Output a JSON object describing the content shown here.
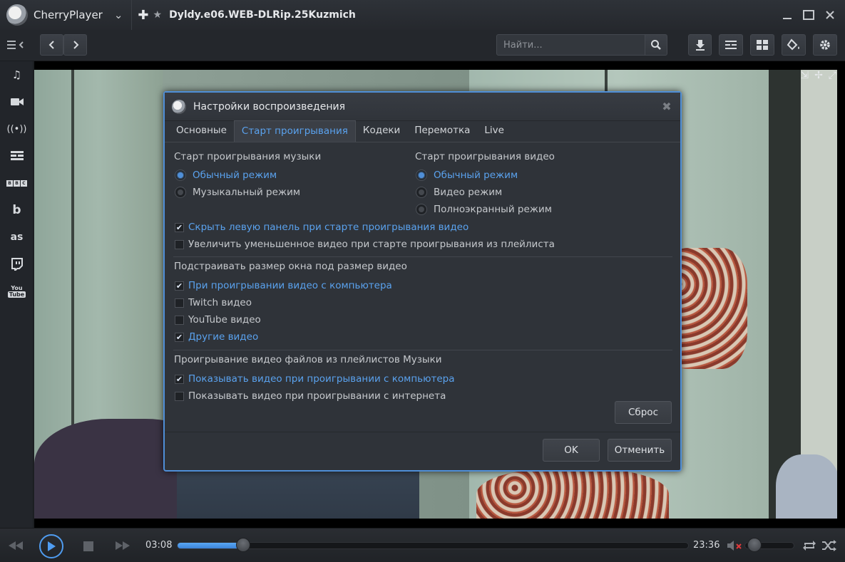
{
  "titlebar": {
    "app_name": "CherryPlayer",
    "doc_title": "Dyldy.e06.WEB-DLRip.25Kuzmich"
  },
  "toolbar": {
    "search_placeholder": "Найти..."
  },
  "dialog": {
    "title": "Настройки воспроизведения",
    "tabs": [
      {
        "label": "Основные",
        "active": false
      },
      {
        "label": "Старт проигрывания",
        "active": true
      },
      {
        "label": "Кодеки",
        "active": false
      },
      {
        "label": "Перемотка",
        "active": false
      },
      {
        "label": "Live",
        "active": false
      }
    ],
    "music_start": {
      "title": "Старт проигрывания музыки",
      "options": [
        {
          "label": "Обычный режим",
          "selected": true
        },
        {
          "label": "Музыкальный режим",
          "selected": false
        }
      ]
    },
    "video_start": {
      "title": "Старт проигрывания видео",
      "options": [
        {
          "label": "Обычный режим",
          "selected": true
        },
        {
          "label": "Видео режим",
          "selected": false
        },
        {
          "label": "Полноэкранный режим",
          "selected": false
        }
      ]
    },
    "checks_general": [
      {
        "label": "Скрыть левую панель при старте проигрывания видео",
        "checked": true
      },
      {
        "label": "Увеличить уменьшенное видео при старте проигрывания из плейлиста",
        "checked": false
      }
    ],
    "resize": {
      "title": "Подстраивать размер окна под размер видео",
      "options": [
        {
          "label": "При проигрывании видео с компьютера",
          "checked": true
        },
        {
          "label": "Twitch видео",
          "checked": false
        },
        {
          "label": "YouTube видео",
          "checked": false
        },
        {
          "label": "Другие видео",
          "checked": true
        }
      ]
    },
    "playlist_video": {
      "title": "Проигрывание видео файлов из плейлистов Музыки",
      "options": [
        {
          "label": "Показывать видео при проигрывании с компьютера",
          "checked": true
        },
        {
          "label": "Показывать видео при проигрывании с интернета",
          "checked": false
        }
      ]
    },
    "reset_label": "Сброс",
    "ok_label": "OK",
    "cancel_label": "Отменить"
  },
  "player": {
    "elapsed": "03:08",
    "total": "23:36",
    "progress": 0.13,
    "volume": 0.05
  },
  "colors": {
    "accent": "#4f8fd8",
    "active_text": "#5aa2ee"
  }
}
